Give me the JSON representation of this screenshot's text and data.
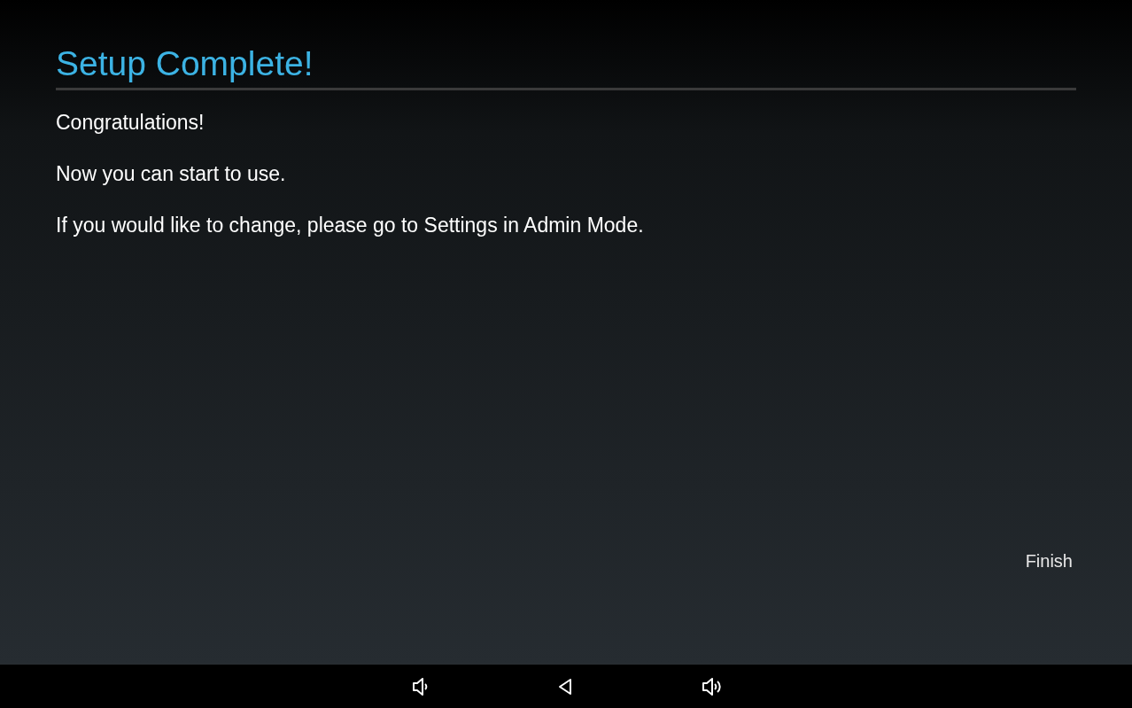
{
  "title": "Setup Complete!",
  "paragraphs": [
    "Congratulations!",
    "Now you can start to use.",
    "If you would like to change, please go to Settings in Admin Mode."
  ],
  "finish_button": "Finish",
  "nav_bar": [
    {
      "kind": "volume-down"
    },
    {
      "kind": "back"
    },
    {
      "kind": "volume-up"
    }
  ]
}
